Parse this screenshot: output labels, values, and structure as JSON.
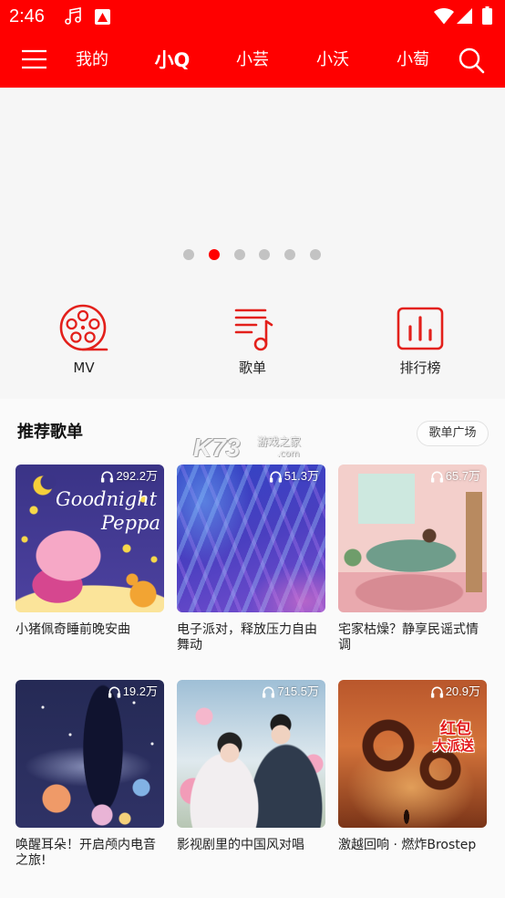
{
  "status_bar": {
    "time": "2:46",
    "left_icons": [
      "music-note-icon",
      "image-icon"
    ],
    "right_icons": [
      "wifi-icon",
      "signal-icon",
      "battery-icon"
    ]
  },
  "nav": {
    "menu_icon": "hamburger-menu-icon",
    "tabs": [
      {
        "label": "我的",
        "active": false
      },
      {
        "label": "小Q",
        "active": true
      },
      {
        "label": "小芸",
        "active": false
      },
      {
        "label": "小沃",
        "active": false
      },
      {
        "label": "小萄",
        "active": false
      }
    ],
    "search_icon": "search-icon"
  },
  "banner": {
    "dots": [
      {
        "active": false
      },
      {
        "active": true
      },
      {
        "active": false
      },
      {
        "active": false
      },
      {
        "active": false
      },
      {
        "active": false
      }
    ]
  },
  "shortcuts": [
    {
      "label": "MV",
      "icon": "film-reel-icon"
    },
    {
      "label": "歌单",
      "icon": "playlist-icon"
    },
    {
      "label": "排行榜",
      "icon": "leaderboard-icon"
    }
  ],
  "recommend": {
    "title": "推荐歌单",
    "more_label": "歌单广场",
    "plays_icon": "headphones-icon",
    "playlists": [
      {
        "title": "小猪佩奇睡前晚安曲",
        "plays": "292.2万",
        "cover_text": [
          "Goodnight",
          "Peppa"
        ]
      },
      {
        "title": "电子派对，释放压力自由舞动",
        "plays": "51.3万"
      },
      {
        "title": "宅家枯燥？静享民谣式情调",
        "plays": "65.7万"
      },
      {
        "title": "唤醒耳朵！开启颅内电音之旅!",
        "plays": "19.2万"
      },
      {
        "title": "影视剧里的中国风对唱",
        "plays": "715.5万"
      },
      {
        "title": "激越回响 · 燃炸Brostep",
        "plays": "20.9万",
        "cover_text": [
          "红包",
          "大派送"
        ]
      }
    ]
  },
  "watermark": {
    "brand": "K73",
    "sub": "游戏之家",
    "domain": ".com"
  },
  "colors": {
    "primary": "#ff0000",
    "icon_accent": "#e3201b",
    "dot_inactive": "#c3c3c3"
  }
}
